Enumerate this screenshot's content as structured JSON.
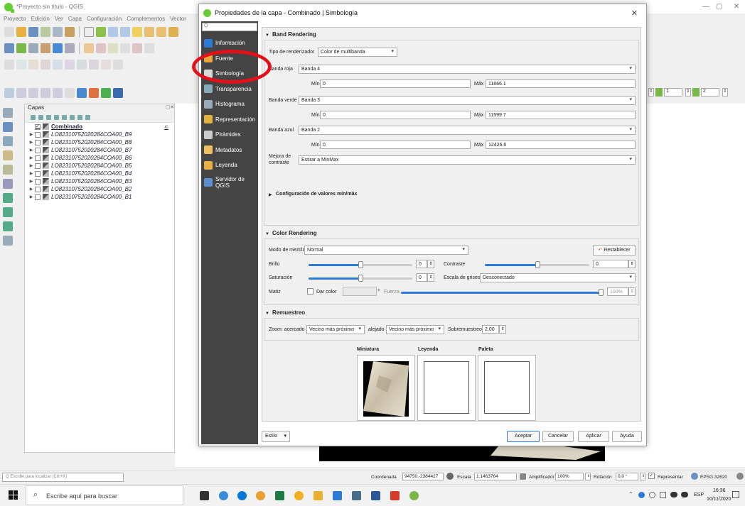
{
  "qgis": {
    "title": "*Proyecto sin título - QGIS",
    "window_controls": [
      "—",
      "▢",
      "✕"
    ],
    "menu": [
      "Proyecto",
      "Edición",
      "Ver",
      "Capa",
      "Configuración",
      "Complementos",
      "Vector"
    ],
    "layers_panel": {
      "title": "Capas",
      "layers": [
        {
          "name": "Combinado",
          "checked": true,
          "bold": true
        },
        {
          "name": "LO82310752020284COA00_B9",
          "checked": false
        },
        {
          "name": "LO82310752020284COA00_B8",
          "checked": false
        },
        {
          "name": "LO82310752020284COA00_B7",
          "checked": false
        },
        {
          "name": "LO82310752020284COA00_B6",
          "checked": false
        },
        {
          "name": "LO82310752020284COA00_B5",
          "checked": false
        },
        {
          "name": "LO82310752020284COA00_B4",
          "checked": false
        },
        {
          "name": "LO82310752020284COA00_B3",
          "checked": false
        },
        {
          "name": "LO82310752020284COA00_B2",
          "checked": false
        },
        {
          "name": "LO82310752020284COA00_B1",
          "checked": false
        }
      ]
    },
    "toolbar_right": {
      "spin1": "1",
      "spin2": "2"
    },
    "status": {
      "locator_placeholder": "Q  Escribe para localizar (Ctrl+K)",
      "coord_label": "Coordenada",
      "coord_value": "94750,-2384427",
      "scale_label": "Escala",
      "scale_value": "1:1463764",
      "amp_label": "Amplificador",
      "amp_value": "100%",
      "rot_label": "Rotación",
      "rot_value": "0,0 °",
      "render_label": "Representar",
      "crs": "EPSG:32620"
    }
  },
  "taskbar": {
    "search_placeholder": "Escribe aquí para buscar",
    "lang": "ESP",
    "time": "16:36",
    "date": "10/11/2020"
  },
  "dialog": {
    "title": "Propiedades de la capa - Combinado | Simbología",
    "close": "✕",
    "search_placeholder": "Q",
    "nav": [
      {
        "label": "Información",
        "icon": "info-icon",
        "color": "#2a7ad6"
      },
      {
        "label": "Fuente",
        "icon": "source-icon",
        "color": "#e9a53a"
      },
      {
        "label": "Simbología",
        "icon": "brush-icon",
        "color": "#d9d9d9"
      },
      {
        "label": "Transparencia",
        "icon": "transparency-icon",
        "color": "#8ab"
      },
      {
        "label": "Histograma",
        "icon": "histogram-icon",
        "color": "#9ab"
      },
      {
        "label": "Representación",
        "icon": "rendering-icon",
        "color": "#e3b23c"
      },
      {
        "label": "Pirámides",
        "icon": "pyramid-icon",
        "color": "#ccc"
      },
      {
        "label": "Metadatos",
        "icon": "metadata-icon",
        "color": "#f0c060"
      },
      {
        "label": "Leyenda",
        "icon": "legend-icon",
        "color": "#e8b040"
      },
      {
        "label": "Servidor de QGIS",
        "icon": "server-icon",
        "color": "#5a8fd0"
      }
    ],
    "band_rendering": {
      "header": "Band Rendering",
      "renderer_label": "Tipo de renderizador",
      "renderer_value": "Color de multibanda",
      "red_label": "Banda roja",
      "red_value": "Banda 4",
      "red_min": "0",
      "red_max": "11866.1",
      "green_label": "Banda verde",
      "green_value": "Banda 3",
      "green_min": "0",
      "green_max": "11599.7",
      "blue_label": "Banda azul",
      "blue_value": "Banda 2",
      "blue_min": "0",
      "blue_max": "12426.6",
      "min_label": "Mín",
      "max_label": "Máx",
      "contrast_label_1": "Mejora de",
      "contrast_label_2": "contraste",
      "contrast_value": "Estirar a MinMax",
      "minmax_header": "Configuración de valores mín/máx"
    },
    "color_rendering": {
      "header": "Color Rendering",
      "blend_label": "Modo de mezcla",
      "blend_value": "Normal",
      "reset_label": "Restablecer",
      "brightness_label": "Brillo",
      "brightness_value": "0",
      "contrast_label": "Contraste",
      "contrast_value": "0",
      "saturation_label": "Saturación",
      "saturation_value": "0",
      "grayscale_label": "Escala de grises",
      "grayscale_value": "Desconectado",
      "hue_label": "Matiz",
      "colorize_label": "Dar color",
      "strength_label": "Fuerza",
      "strength_value": "100%",
      "brightness_level": 0.5,
      "contrast_level": 0.5,
      "saturation_level": 0.5,
      "strength_level": 1.0
    },
    "resampling": {
      "header": "Remuestreo",
      "zoomin_label": "Zoom: acercado",
      "zoomin_value": "Vecino más próximo",
      "zoomout_label": "alejado",
      "zoomout_value": "Vecino más próximo",
      "oversample_label": "Sobremuestreo",
      "oversample_value": "2,00"
    },
    "previews": {
      "thumb": "Miniatura",
      "legend": "Leyenda",
      "palette": "Paleta"
    },
    "buttons": {
      "style": "Estilo",
      "accept": "Aceptar",
      "cancel": "Cancelar",
      "apply": "Aplicar",
      "help": "Ayuda"
    }
  },
  "colors": {
    "accent": "#2a7ad6",
    "highlight": "#e3101a",
    "nav_bg": "#444444"
  }
}
